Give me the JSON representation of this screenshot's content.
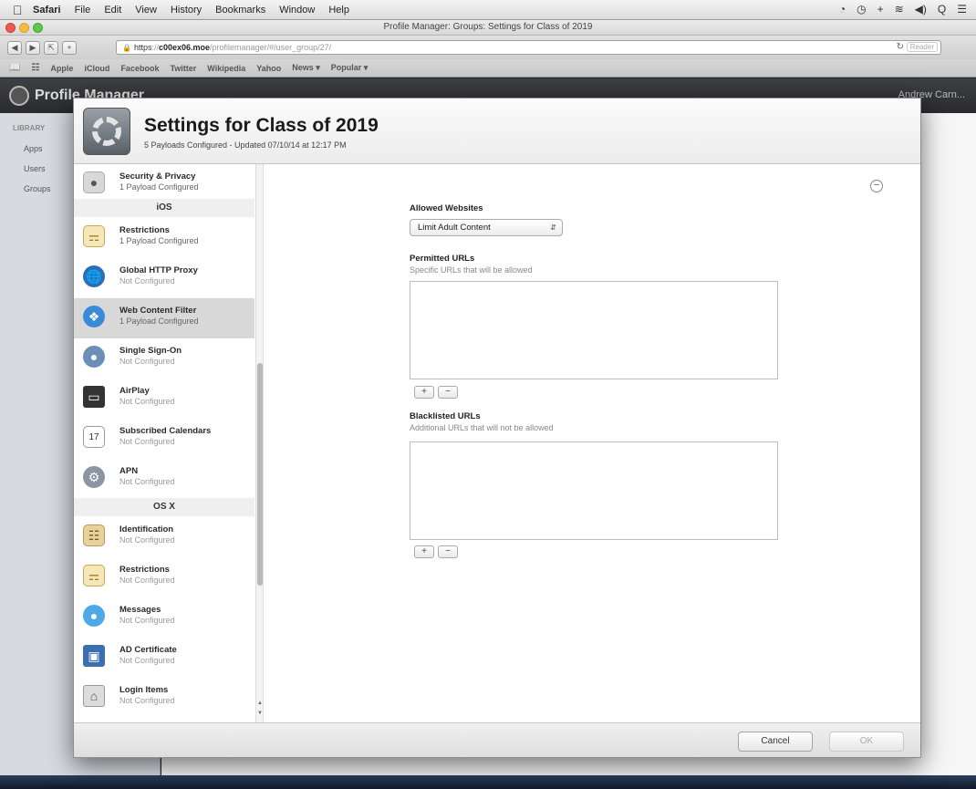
{
  "menubar": {
    "items": [
      "Safari",
      "File",
      "Edit",
      "View",
      "History",
      "Bookmarks",
      "Window",
      "Help"
    ],
    "status_icons": [
      "◔",
      "◷",
      "+",
      "≋",
      "◀)",
      "Q",
      "☰"
    ]
  },
  "window": {
    "title": "Profile Manager: Groups: Settings for Class of 2019",
    "url_scheme": "https",
    "url_host": "c00ex06.moe",
    "url_path": "/profilemanager/#/user_group/27/",
    "reader_label": "Reader"
  },
  "bookmarks": [
    "Apple",
    "iCloud",
    "Facebook",
    "Twitter",
    "Wikipedia",
    "Yahoo",
    "News ▾",
    "Popular ▾"
  ],
  "app": {
    "name": "Profile Manager",
    "user": "Andrew Carn...",
    "library_label": "LIBRARY",
    "sidebar": [
      "Apps",
      "Users",
      "Groups"
    ]
  },
  "sheet": {
    "title": "Settings for Class of 2019",
    "subtitle": "5 Payloads Configured - Updated 07/10/14 at 12:17 PM",
    "payloads_top": [
      {
        "title": "Security & Privacy",
        "status": "1 Payload Configured",
        "icon": "lock-icon",
        "configured": true
      }
    ],
    "section_ios": "iOS",
    "payloads_ios": [
      {
        "title": "Restrictions",
        "status": "1 Payload Configured",
        "icon": "restrictions-icon",
        "configured": true
      },
      {
        "title": "Global HTTP Proxy",
        "status": "Not Configured",
        "icon": "globe-icon",
        "configured": false
      },
      {
        "title": "Web Content Filter",
        "status": "1 Payload Configured",
        "icon": "safari-icon",
        "configured": true,
        "selected": true
      },
      {
        "title": "Single Sign-On",
        "status": "Not Configured",
        "icon": "sso-icon",
        "configured": false
      },
      {
        "title": "AirPlay",
        "status": "Not Configured",
        "icon": "airplay-icon",
        "configured": false
      },
      {
        "title": "Subscribed Calendars",
        "status": "Not Configured",
        "icon": "calendar-icon",
        "configured": false
      },
      {
        "title": "APN",
        "status": "Not Configured",
        "icon": "gear-icon",
        "configured": false
      }
    ],
    "section_osx": "OS X",
    "payloads_osx": [
      {
        "title": "Identification",
        "status": "Not Configured",
        "icon": "id-card-icon",
        "configured": false
      },
      {
        "title": "Restrictions",
        "status": "Not Configured",
        "icon": "restrictions-icon",
        "configured": false
      },
      {
        "title": "Messages",
        "status": "Not Configured",
        "icon": "messages-icon",
        "configured": false
      },
      {
        "title": "AD Certificate",
        "status": "Not Configured",
        "icon": "certificate-icon",
        "configured": false
      },
      {
        "title": "Login Items",
        "status": "Not Configured",
        "icon": "login-items-icon",
        "configured": false
      }
    ],
    "form": {
      "allowed_websites_label": "Allowed Websites",
      "allowed_websites_value": "Limit Adult Content",
      "permitted_label": "Permitted URLs",
      "permitted_hint": "Specific URLs that will be allowed",
      "blacklisted_label": "Blacklisted URLs",
      "blacklisted_hint": "Additional URLs that will not be allowed",
      "add_label": "+",
      "remove_label": "−",
      "remove_payload_label": "−"
    },
    "cancel_label": "Cancel",
    "ok_label": "OK"
  }
}
